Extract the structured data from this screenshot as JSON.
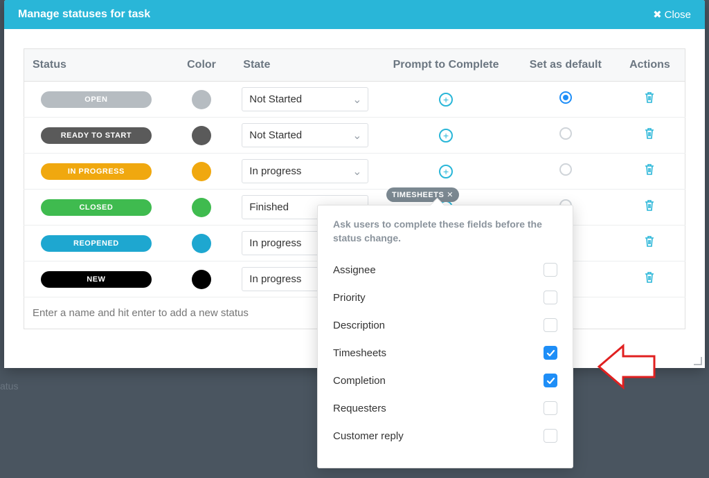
{
  "modal": {
    "title": "Manage statuses for task",
    "close": "Close"
  },
  "columns": {
    "status": "Status",
    "color": "Color",
    "state": "State",
    "prompt": "Prompt to Complete",
    "default": "Set as default",
    "actions": "Actions"
  },
  "rows": [
    {
      "name": "OPEN",
      "pill_color": "#b6bcc1",
      "swatch": "#b6bcc1",
      "state": "Not Started",
      "show_chevron": true,
      "default": true
    },
    {
      "name": "READY TO START",
      "pill_color": "#5a5a5a",
      "swatch": "#5a5a5a",
      "state": "Not Started",
      "show_chevron": true,
      "default": false
    },
    {
      "name": "IN PROGRESS",
      "pill_color": "#f0a80f",
      "swatch": "#f0a80f",
      "state": "In progress",
      "show_chevron": true,
      "default": false
    },
    {
      "name": "CLOSED",
      "pill_color": "#3fbb4f",
      "swatch": "#3fbb4f",
      "state": "Finished",
      "show_chevron": false,
      "default": false
    },
    {
      "name": "REOPENED",
      "pill_color": "#1ea7d0",
      "swatch": "#1ea7d0",
      "state": "In progress",
      "show_chevron": false,
      "default": false
    },
    {
      "name": "NEW",
      "pill_color": "#000000",
      "swatch": "#000000",
      "state": "In progress",
      "show_chevron": false,
      "default": false
    }
  ],
  "new_status_placeholder": "Enter a name and hit enter to add a new status",
  "tag": {
    "label": "TIMESHEETS"
  },
  "popover": {
    "desc": "Ask users to complete these fields before the status change.",
    "options": [
      {
        "label": "Assignee",
        "checked": false
      },
      {
        "label": "Priority",
        "checked": false
      },
      {
        "label": "Description",
        "checked": false
      },
      {
        "label": "Timesheets",
        "checked": true
      },
      {
        "label": "Completion",
        "checked": true
      },
      {
        "label": "Requesters",
        "checked": false
      },
      {
        "label": "Customer reply",
        "checked": false
      }
    ]
  },
  "bg_label": "atus"
}
